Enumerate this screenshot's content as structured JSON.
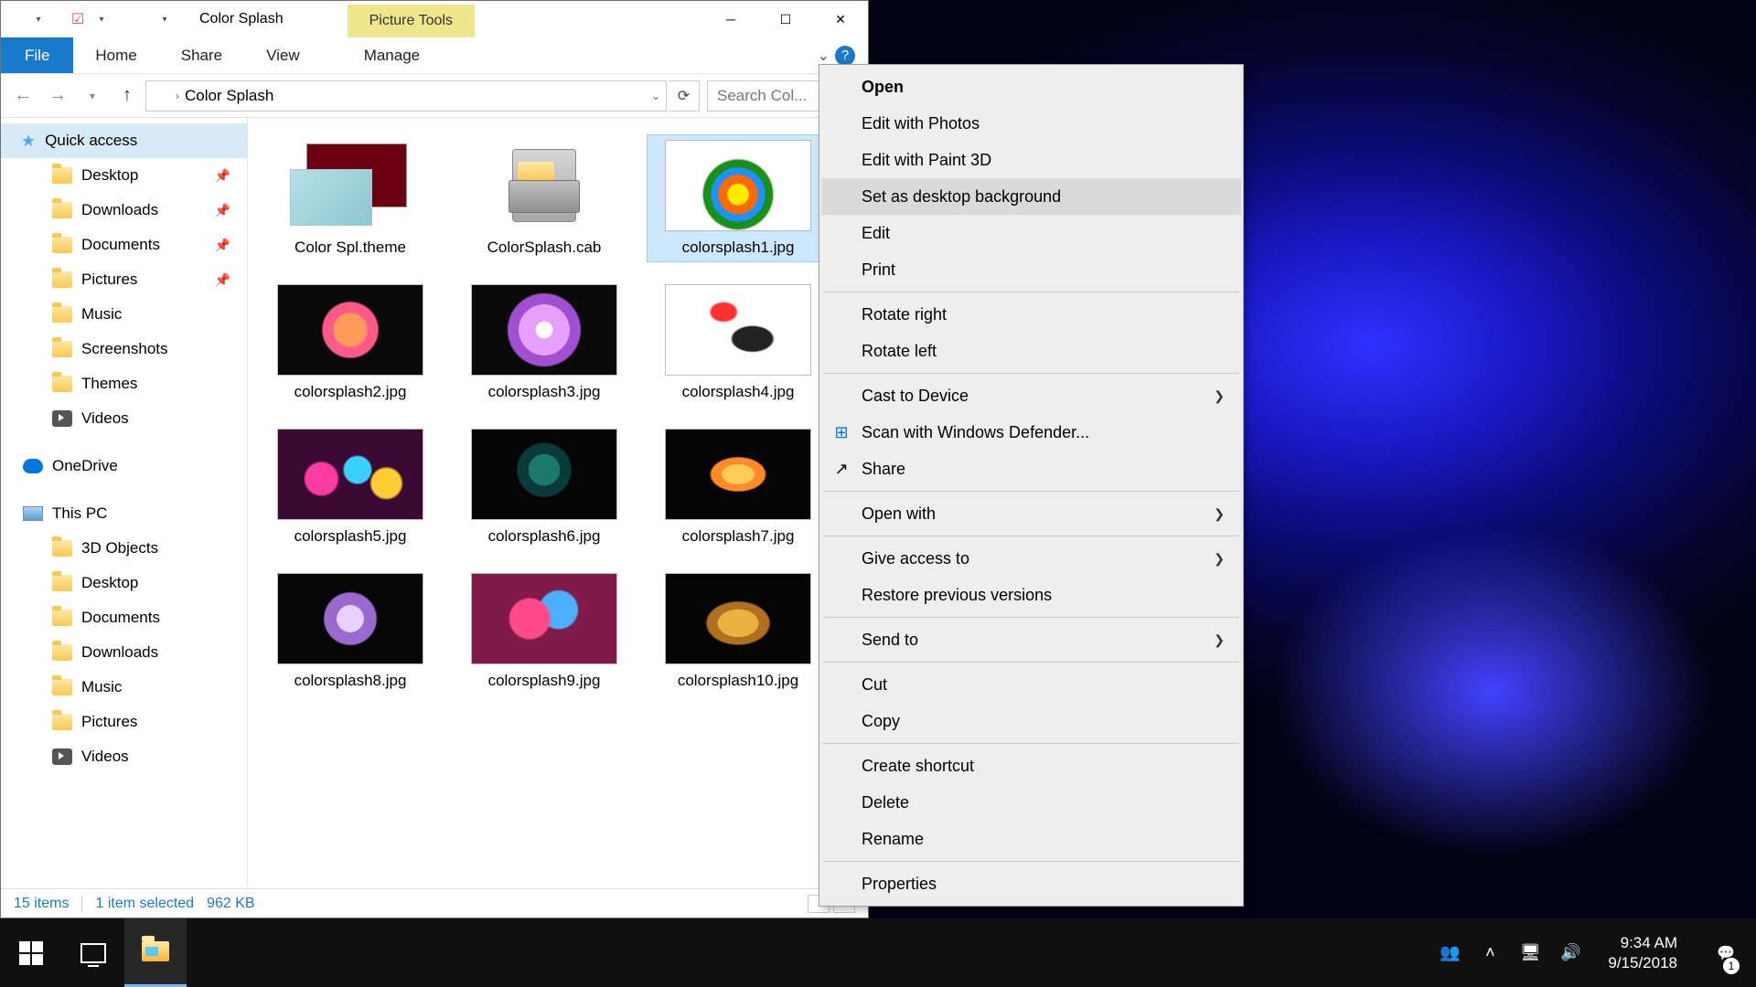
{
  "window": {
    "title": "Color Splash",
    "contextual_tab": "Picture Tools"
  },
  "ribbon": {
    "file": "File",
    "home": "Home",
    "share": "Share",
    "view": "View",
    "manage": "Manage"
  },
  "address": {
    "folder": "Color Splash",
    "search_placeholder": "Search Col..."
  },
  "sidebar": {
    "quick_access": "Quick access",
    "desktop": "Desktop",
    "downloads": "Downloads",
    "documents": "Documents",
    "pictures": "Pictures",
    "music": "Music",
    "screenshots": "Screenshots",
    "themes": "Themes",
    "videos": "Videos",
    "onedrive": "OneDrive",
    "this_pc": "This PC",
    "objects3d": "3D Objects",
    "desktop2": "Desktop",
    "documents2": "Documents",
    "downloads2": "Downloads",
    "music2": "Music",
    "pictures2": "Pictures",
    "videos2": "Videos"
  },
  "files": [
    {
      "name": "Color Spl.theme",
      "kind": "theme"
    },
    {
      "name": "ColorSplash.cab",
      "kind": "cab"
    },
    {
      "name": "colorsplash1.jpg",
      "kind": "img",
      "cls": "sg1",
      "selected": true,
      "white": true
    },
    {
      "name": "colorsplash2.jpg",
      "kind": "img",
      "cls": "sg2"
    },
    {
      "name": "colorsplash3.jpg",
      "kind": "img",
      "cls": "sg3"
    },
    {
      "name": "colorsplash4.jpg",
      "kind": "img",
      "cls": "sg4",
      "white": true
    },
    {
      "name": "colorsplash5.jpg",
      "kind": "img",
      "cls": "sg5"
    },
    {
      "name": "colorsplash6.jpg",
      "kind": "img",
      "cls": "sg6"
    },
    {
      "name": "colorsplash7.jpg",
      "kind": "img",
      "cls": "sg7"
    },
    {
      "name": "colorsplash8.jpg",
      "kind": "img",
      "cls": "sg8"
    },
    {
      "name": "colorsplash9.jpg",
      "kind": "img",
      "cls": "sg9"
    },
    {
      "name": "colorsplash10.jpg",
      "kind": "img",
      "cls": "sg10"
    }
  ],
  "status": {
    "items": "15 items",
    "selected": "1 item selected",
    "size": "962 KB"
  },
  "context_menu": {
    "open": "Open",
    "edit_photos": "Edit with Photos",
    "edit_paint3d": "Edit with Paint 3D",
    "set_bg": "Set as desktop background",
    "edit": "Edit",
    "print": "Print",
    "rotate_right": "Rotate right",
    "rotate_left": "Rotate left",
    "cast": "Cast to Device",
    "defender": "Scan with Windows Defender...",
    "share": "Share",
    "open_with": "Open with",
    "give_access": "Give access to",
    "restore": "Restore previous versions",
    "send_to": "Send to",
    "cut": "Cut",
    "copy": "Copy",
    "create_shortcut": "Create shortcut",
    "delete": "Delete",
    "rename": "Rename",
    "properties": "Properties"
  },
  "taskbar": {
    "time": "9:34 AM",
    "date": "9/15/2018",
    "notifications": "1"
  }
}
